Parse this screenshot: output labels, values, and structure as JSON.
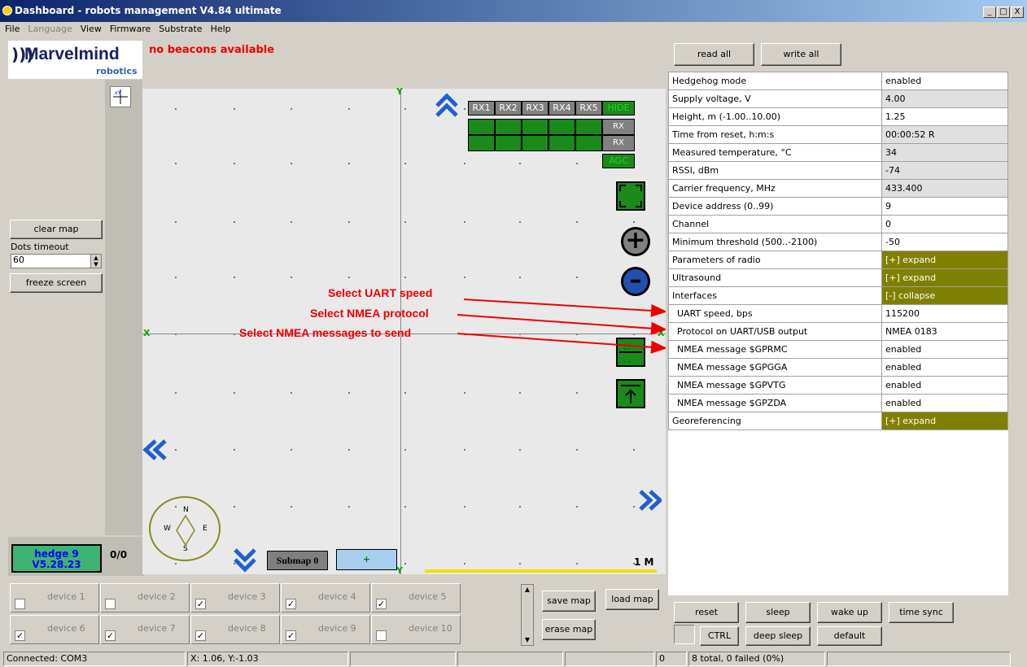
{
  "window": {
    "title": "Dashboard - robots management  V4.84  ultimate",
    "btn_min": "_",
    "btn_max": "□",
    "btn_close": "X"
  },
  "menu": [
    "File",
    "Language",
    "View",
    "Firmware",
    "Substrate",
    "Help"
  ],
  "logo": {
    "main": "Marvelmind",
    "sub": "robotics"
  },
  "left": {
    "clear_map": "clear map",
    "dots_timeout_label": "Dots timeout",
    "dots_timeout_value": "60",
    "freeze_screen": "freeze screen",
    "hedge_line1": "hedge 9",
    "hedge_line2": "V5.28.23",
    "counter": "0/0"
  },
  "map": {
    "no_beacons": "no beacons available",
    "axis_y": "Y",
    "axis_x": "X",
    "rx_headers": [
      "RX1",
      "RX2",
      "RX3",
      "RX4",
      "RX5"
    ],
    "hide": "HIDE",
    "rx_normal": "RX normal",
    "rx_frozen": "RX frozen",
    "agc": "AGC",
    "submap": "Submap 0",
    "submap_add": "+",
    "scale": "1 M",
    "compass": {
      "n": "N",
      "s": "S",
      "w": "W",
      "e": "E"
    },
    "annotations": [
      "Select UART speed",
      "Select NMEA protocol",
      "Select NMEA messages to send"
    ]
  },
  "right": {
    "read_all": "read all",
    "write_all": "write all",
    "properties": [
      {
        "name": "Hedgehog mode",
        "value": "enabled",
        "style": "white"
      },
      {
        "name": "Supply voltage, V",
        "value": "4.00",
        "style": "gray"
      },
      {
        "name": "Height, m (-1.00..10.00)",
        "value": "1.25",
        "style": "white"
      },
      {
        "name": "Time from reset, h:m:s",
        "value": "00:00:52  R",
        "style": "gray"
      },
      {
        "name": "Measured temperature, °C",
        "value": "34",
        "style": "gray"
      },
      {
        "name": "RSSI, dBm",
        "value": "-74",
        "style": "gray"
      },
      {
        "name": "Carrier frequency, MHz",
        "value": "433.400",
        "style": "gray"
      },
      {
        "name": "Device address (0..99)",
        "value": "9",
        "style": "white"
      },
      {
        "name": "Channel",
        "value": "0",
        "style": "white"
      },
      {
        "name": "Minimum threshold (500..-2100)",
        "value": "-50",
        "style": "white"
      },
      {
        "name": "Parameters of radio",
        "value": "[+] expand",
        "style": "olive"
      },
      {
        "name": "Ultrasound",
        "value": "[+] expand",
        "style": "olive"
      },
      {
        "name": "Interfaces",
        "value": "[-] collapse",
        "style": "olive"
      },
      {
        "name": "  UART speed, bps",
        "value": "115200",
        "style": "white"
      },
      {
        "name": "  Protocol on UART/USB output",
        "value": "NMEA 0183",
        "style": "white"
      },
      {
        "name": "  NMEA message $GPRMC",
        "value": "enabled",
        "style": "white"
      },
      {
        "name": "  NMEA message $GPGGA",
        "value": "enabled",
        "style": "white"
      },
      {
        "name": "  NMEA message $GPVTG",
        "value": "enabled",
        "style": "white"
      },
      {
        "name": "  NMEA message $GPZDA",
        "value": "enabled",
        "style": "white"
      },
      {
        "name": "Georeferencing",
        "value": "[+] expand",
        "style": "olive"
      }
    ],
    "buttons": {
      "reset": "reset",
      "sleep": "sleep",
      "wake_up": "wake up",
      "time_sync": "time sync",
      "ctrl": "CTRL",
      "deep_sleep": "deep sleep",
      "default": "default"
    }
  },
  "devices": [
    {
      "label": "device 1",
      "checked": false
    },
    {
      "label": "device 2",
      "checked": false
    },
    {
      "label": "device 3",
      "checked": true
    },
    {
      "label": "device 4",
      "checked": true
    },
    {
      "label": "device 5",
      "checked": true
    },
    {
      "label": "device 6",
      "checked": true
    },
    {
      "label": "device 7",
      "checked": true
    },
    {
      "label": "device 8",
      "checked": true
    },
    {
      "label": "device 9",
      "checked": true
    },
    {
      "label": "device 10",
      "checked": false
    }
  ],
  "map_buttons": {
    "save_map": "save map",
    "load_map": "load map",
    "erase_map": "erase map"
  },
  "status": {
    "connected": "Connected: COM3",
    "coords": "X: 1.06, Y:-1.03",
    "zero": "0",
    "total": "8 total, 0 failed (0%)"
  }
}
